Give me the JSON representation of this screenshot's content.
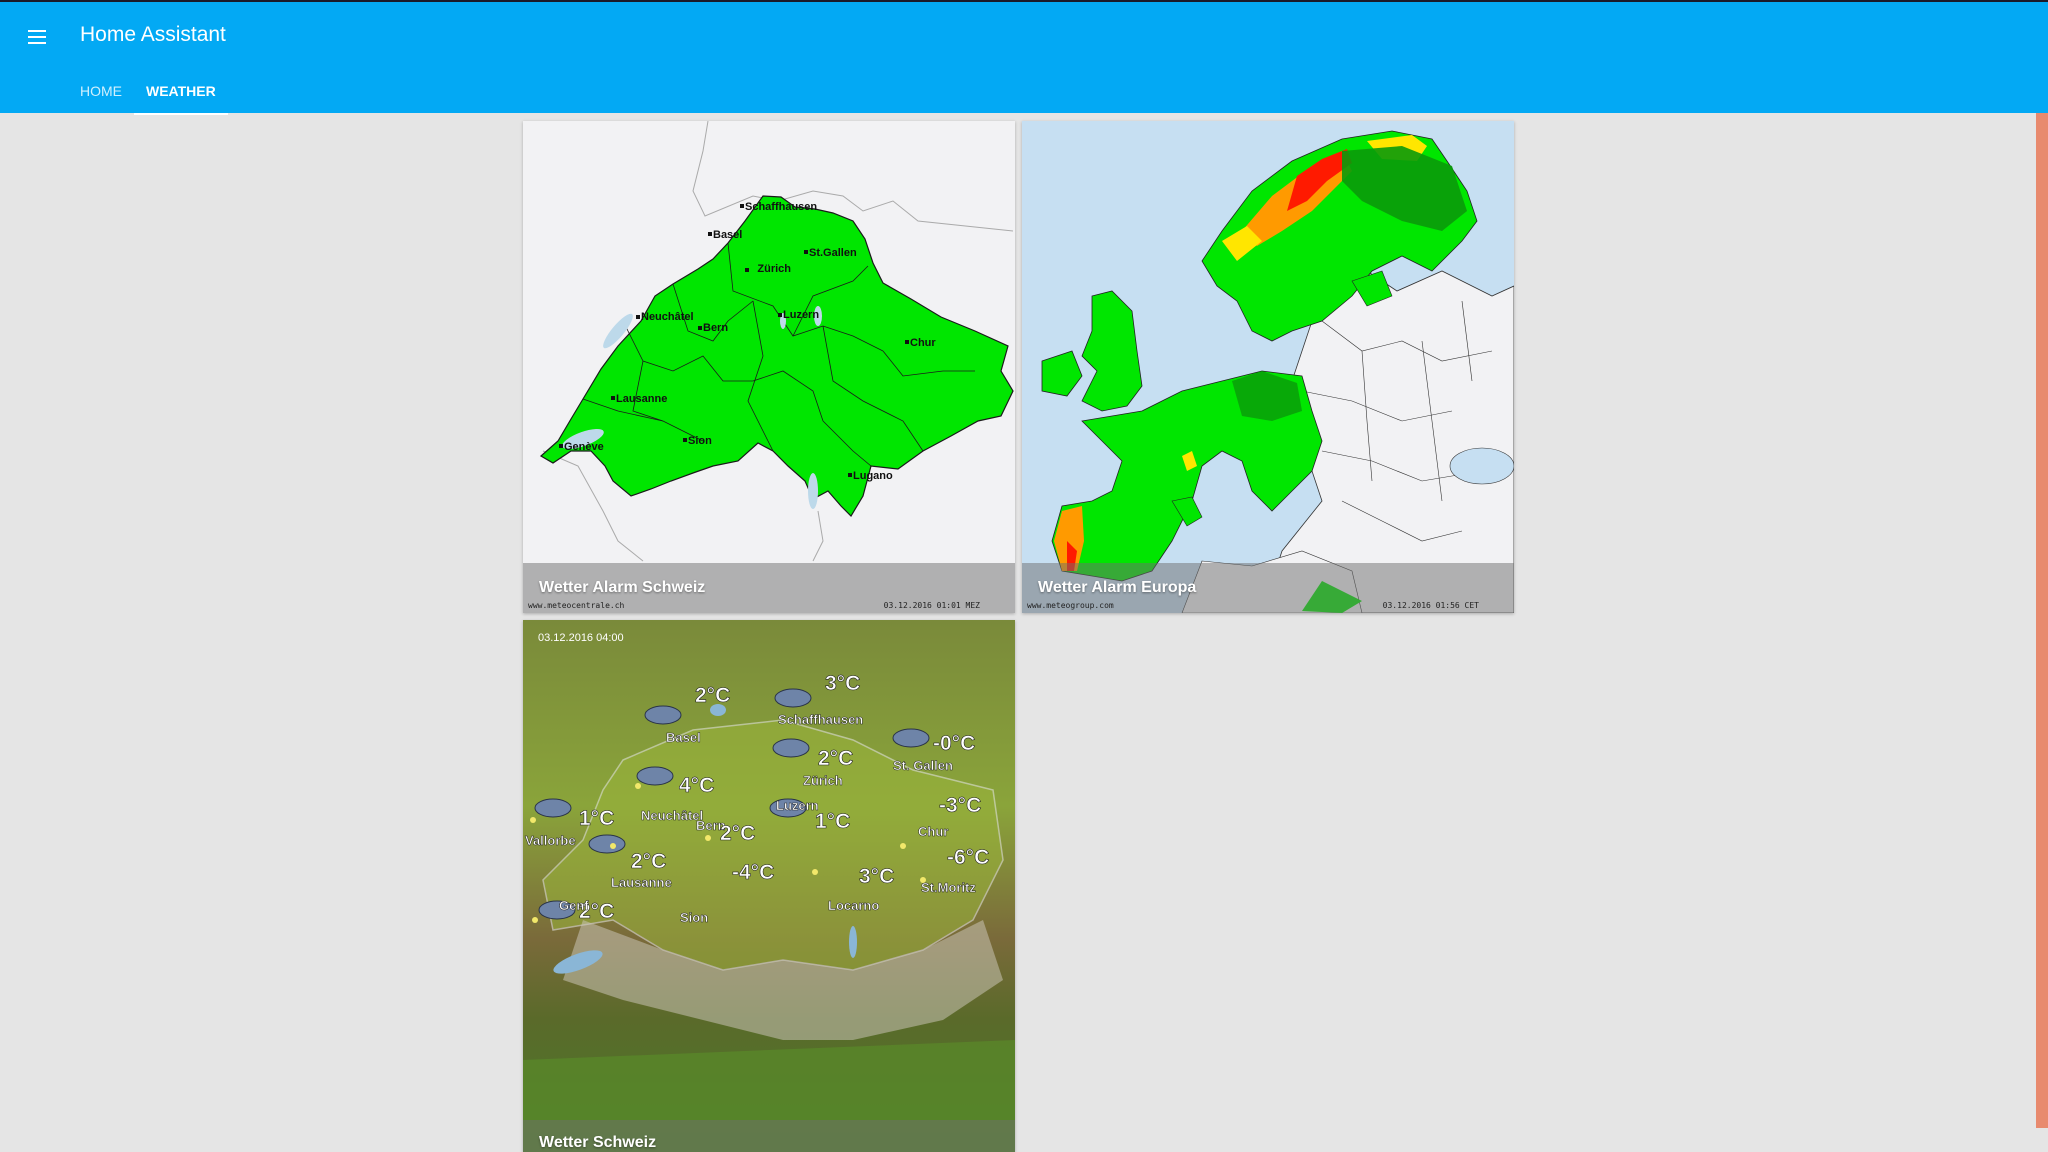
{
  "app": {
    "title": "Home Assistant"
  },
  "tabs": [
    {
      "label": "HOME",
      "active": false
    },
    {
      "label": "WEATHER",
      "active": true
    }
  ],
  "cards": [
    {
      "title": "Wetter Alarm Schweiz",
      "source": "www.meteocentrale.ch",
      "timestamp": "03.12.2016 01:01 MEZ",
      "cities": [
        "Schaffhausen",
        "Basel",
        "St.Gallen",
        "Zürich",
        "Neuchâtel",
        "Luzern",
        "Bern",
        "Chur",
        "Lausanne",
        "Sion",
        "Genève",
        "Lugano"
      ]
    },
    {
      "title": "Wetter Alarm Europa",
      "source": "www.meteogroup.com",
      "timestamp": "03.12.2016 01:56 CET"
    },
    {
      "title": "Wetter Schweiz",
      "date": "03.12.2016 04:00",
      "forecast": [
        {
          "city": "Basel",
          "temp": "2°C"
        },
        {
          "city": "Schaffhausen",
          "temp": "3°C"
        },
        {
          "city": "St. Gallen",
          "temp": "-0°C"
        },
        {
          "city": "Zürich",
          "temp": "2°C"
        },
        {
          "city": "Neuchâtel",
          "temp": "4°C"
        },
        {
          "city": "Luzern",
          "temp": ""
        },
        {
          "city": "Chur",
          "temp": "-3°C"
        },
        {
          "city": "Vallorbe",
          "temp": "1°C"
        },
        {
          "city": "Bern",
          "temp": "1°C"
        },
        {
          "city": "Lausanne",
          "temp": "2°C"
        },
        {
          "city": "St.Moritz",
          "temp": "-6°C"
        },
        {
          "city": "Genf",
          "temp": "2°C"
        },
        {
          "city": "Sion",
          "temp": "-4°C"
        },
        {
          "city": "Locarno",
          "temp": "3°C"
        },
        {
          "city": "",
          "temp": "2°C"
        }
      ]
    }
  ],
  "colors": {
    "header": "#03a9f4",
    "background": "#e5e5e5",
    "alert_green": "#00e600",
    "scrollbar": "#e88a6e"
  }
}
